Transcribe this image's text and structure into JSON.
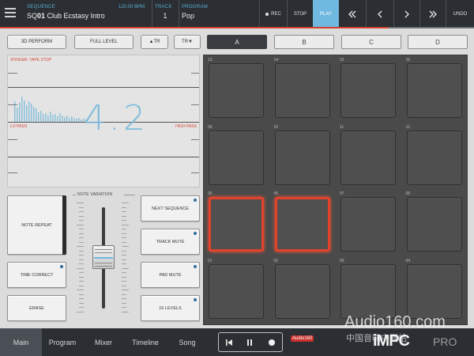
{
  "topbar": {
    "sequence_label": "SEQUENCE",
    "sequence_prefix": "SQ",
    "sequence_number": "01",
    "sequence_name": "Club Ecstasy Intro",
    "bpm": "120.00 BPM",
    "track_label": "TRACK",
    "track_value": "1",
    "program_label": "PROGRAM",
    "program_value": "Pop",
    "rec_label": "REC",
    "stop_label": "STOP",
    "play_label": "PLAY",
    "undo_label": "UNDO",
    "progress_fraction": 0.82
  },
  "modes": {
    "perform_3d": "3D PERFORM",
    "full_level": "FULL LEVEL",
    "track_up": "▲TR",
    "track_down": "TR▼"
  },
  "banks": [
    "A",
    "B",
    "C",
    "D"
  ],
  "active_bank": "A",
  "xy_pad": {
    "top_label": "2FINGER: TAPE STOP",
    "low_pass": "LO PASS",
    "high_pass": "HIGH PASS",
    "value": "4.2"
  },
  "left_buttons": {
    "note_repeat": "NOTE REPEAT",
    "time_correct": "TIME CORRECT",
    "erase": "ERASE",
    "note_variation": "NOTE VARIATION",
    "next_sequence": "NEXT SEQUENCE",
    "track_mute": "TRACK MUTE",
    "pad_mute": "PAD MUTE",
    "sixteen_levels": "16 LEVELS"
  },
  "pads": [
    {
      "num": "13",
      "hit": false
    },
    {
      "num": "14",
      "hit": false
    },
    {
      "num": "15",
      "hit": false
    },
    {
      "num": "16",
      "hit": false
    },
    {
      "num": "09",
      "hit": false
    },
    {
      "num": "10",
      "hit": false
    },
    {
      "num": "11",
      "hit": false
    },
    {
      "num": "12",
      "hit": false
    },
    {
      "num": "05",
      "hit": true
    },
    {
      "num": "06",
      "hit": true
    },
    {
      "num": "07",
      "hit": false
    },
    {
      "num": "08",
      "hit": false
    },
    {
      "num": "01",
      "hit": false
    },
    {
      "num": "02",
      "hit": false
    },
    {
      "num": "03",
      "hit": false
    },
    {
      "num": "04",
      "hit": false
    }
  ],
  "bottom_tabs": [
    "Main",
    "Program",
    "Mixer",
    "Timeline",
    "Song"
  ],
  "active_tab": "Main",
  "branding": {
    "audio_badge": "Audio160",
    "watermark_url": "Audio160.com",
    "watermark_cn": "中国音响中网站",
    "product": "iMPC",
    "product_suffix": "PRO"
  },
  "colors": {
    "accent_blue": "#6fb8e0",
    "pad_hit_red": "#e2412a",
    "topbar": "#2b2f33"
  }
}
